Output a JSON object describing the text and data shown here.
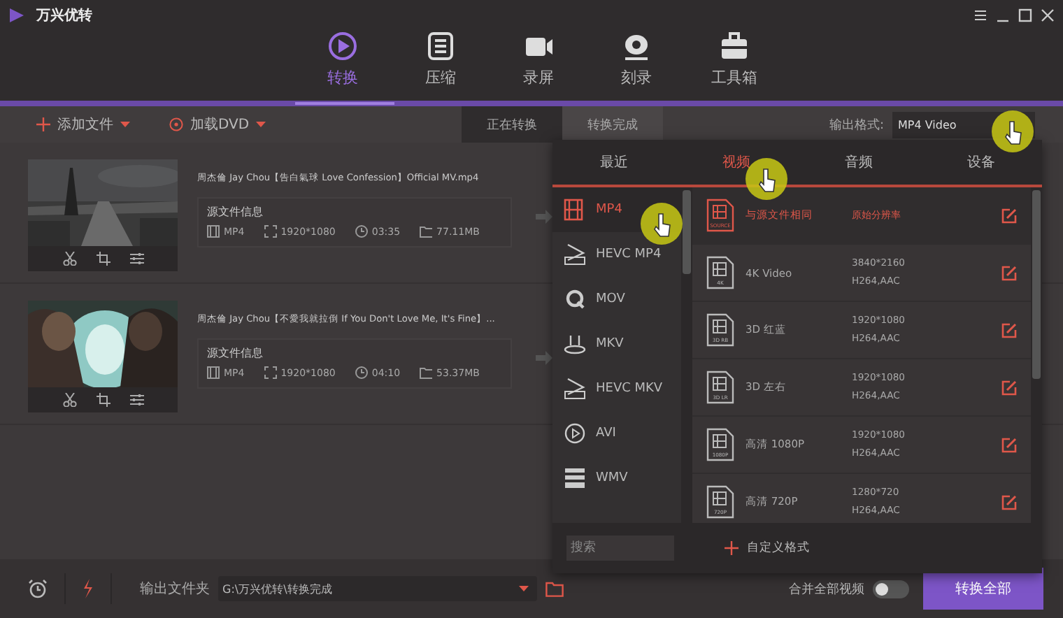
{
  "app": {
    "title": "万兴优转"
  },
  "nav_tabs": [
    {
      "label": "转换",
      "kind": "convert",
      "selected": true
    },
    {
      "label": "压缩",
      "kind": "compress",
      "selected": false
    },
    {
      "label": "录屏",
      "kind": "record",
      "selected": false
    },
    {
      "label": "刻录",
      "kind": "burn",
      "selected": false
    },
    {
      "label": "工具箱",
      "kind": "toolbox",
      "selected": false
    }
  ],
  "toolbar": {
    "add_file": "添加文件",
    "load_dvd": "加载DVD",
    "view_tabs": [
      {
        "label": "正在转换",
        "selected": true
      },
      {
        "label": "转换完成",
        "selected": false
      }
    ],
    "output_format_label": "输出格式:",
    "output_format_value": "MP4 Video"
  },
  "files": [
    {
      "name": "周杰倫 Jay Chou【告白氣球 Love Confession】Official MV.mp4",
      "info_title": "源文件信息",
      "format": "MP4",
      "resolution": "1920*1080",
      "duration": "03:35",
      "size": "77.11MB"
    },
    {
      "name": "周杰倫 Jay Chou【不愛我就拉倒 If You Don't Love Me, It's Fine】...",
      "info_title": "源文件信息",
      "format": "MP4",
      "resolution": "1920*1080",
      "duration": "04:10",
      "size": "53.37MB"
    }
  ],
  "format_panel": {
    "tabs": [
      {
        "label": "最近",
        "selected": false
      },
      {
        "label": "视频",
        "selected": true
      },
      {
        "label": "音频",
        "selected": false
      },
      {
        "label": "设备",
        "selected": false
      }
    ],
    "formats": [
      {
        "label": "MP4",
        "kind": "film",
        "selected": true
      },
      {
        "label": "HEVC MP4",
        "kind": "hevc",
        "selected": false
      },
      {
        "label": "MOV",
        "kind": "quick",
        "selected": false
      },
      {
        "label": "MKV",
        "kind": "mkv",
        "selected": false
      },
      {
        "label": "HEVC MKV",
        "kind": "hevc",
        "selected": false
      },
      {
        "label": "AVI",
        "kind": "play",
        "selected": false
      },
      {
        "label": "WMV",
        "kind": "clapper",
        "selected": false
      }
    ],
    "presets": [
      {
        "name": "与源文件相同",
        "badge": "SOURCE",
        "detail": "原始分辨率",
        "selected": true
      },
      {
        "name": "4K Video",
        "badge": "4K",
        "resolution": "3840*2160",
        "codec": "H264,AAC",
        "selected": false
      },
      {
        "name": "3D 红蓝",
        "badge": "3D RB",
        "resolution": "1920*1080",
        "codec": "H264,AAC",
        "selected": false
      },
      {
        "name": "3D 左右",
        "badge": "3D LR",
        "resolution": "1920*1080",
        "codec": "H264,AAC",
        "selected": false
      },
      {
        "name": "高清 1080P",
        "badge": "1080P",
        "resolution": "1920*1080",
        "codec": "H264,AAC",
        "selected": false
      },
      {
        "name": "高清 720P",
        "badge": "720P",
        "resolution": "1280*720",
        "codec": "H264,AAC",
        "selected": false
      }
    ],
    "search": {
      "placeholder": "搜索"
    },
    "custom_format": "自定义格式"
  },
  "bottom_bar": {
    "output_folder_label": "输出文件夹",
    "output_folder_path": "G:\\万兴优转\\转换完成",
    "merge_label": "合并全部视频",
    "merge_on": false,
    "convert_all": "转换全部"
  }
}
